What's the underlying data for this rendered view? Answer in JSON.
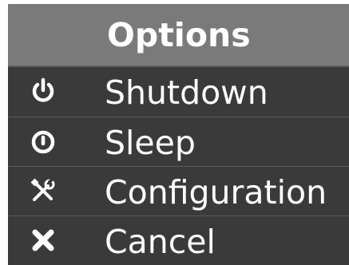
{
  "menu": {
    "title": "Options",
    "items": [
      {
        "label": "Shutdown",
        "icon": "power-icon"
      },
      {
        "label": "Sleep",
        "icon": "sleep-icon"
      },
      {
        "label": "Configuration",
        "icon": "tools-icon"
      },
      {
        "label": "Cancel",
        "icon": "close-icon"
      }
    ]
  },
  "colors": {
    "header_bg": "#7a7a7a",
    "item_bg": "#3a3a3a",
    "text": "#ffffff"
  }
}
